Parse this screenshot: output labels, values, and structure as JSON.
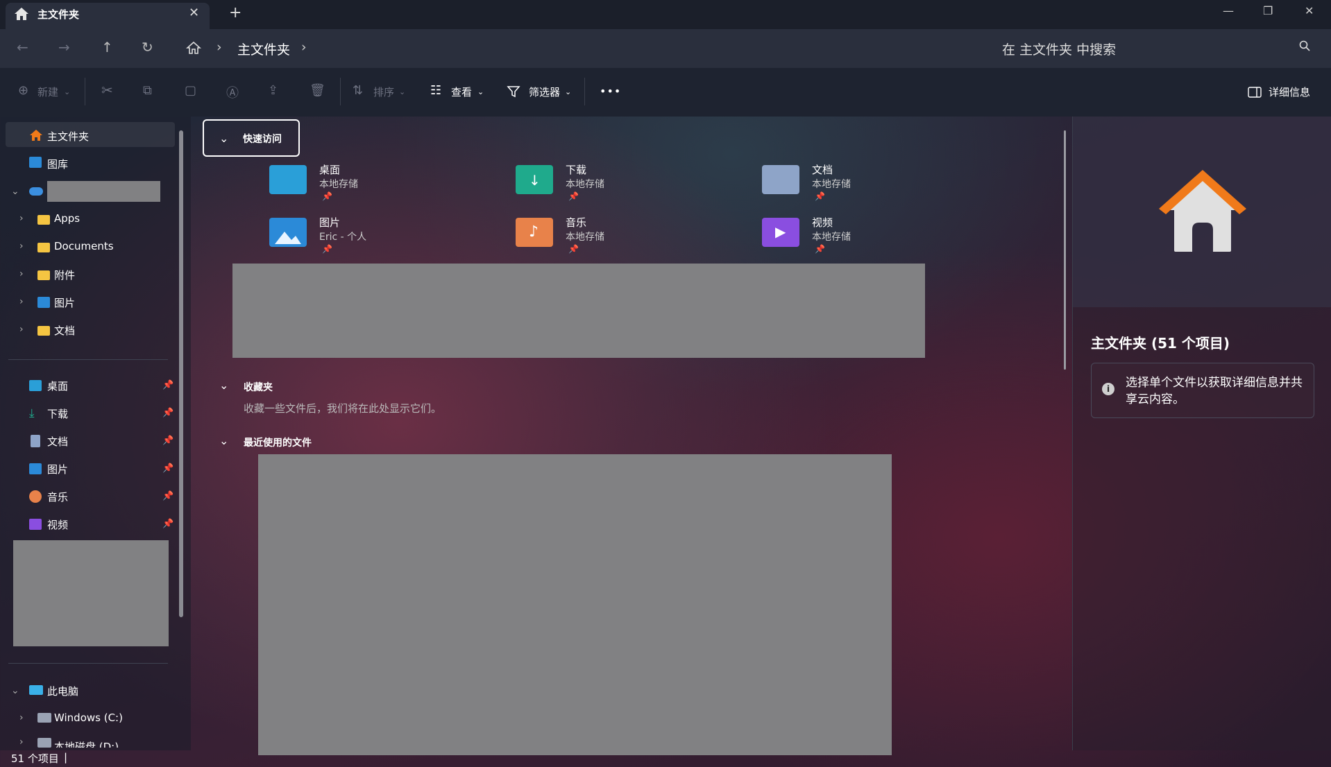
{
  "titlebar": {
    "tab_title": "主文件夹",
    "tab_close": "✕",
    "new_tab": "+",
    "minimize": "—",
    "restore": "❐",
    "close": "✕"
  },
  "nav": {
    "back": "←",
    "forward": "→",
    "up": "↑",
    "refresh": "↻",
    "breadcrumb": "主文件夹",
    "search_placeholder": "在 主文件夹 中搜索"
  },
  "toolbar": {
    "new_label": "新建",
    "sort_label": "排序",
    "view_label": "查看",
    "filter_label": "筛选器",
    "more_label": "•••",
    "details_label": "详细信息"
  },
  "sidebar": {
    "home": "主文件夹",
    "gallery": "图库",
    "onedrive_children": [
      "Apps",
      "Documents",
      "附件",
      "图片",
      "文档"
    ],
    "pinned": [
      "桌面",
      "下载",
      "文档",
      "图片",
      "音乐",
      "视频"
    ],
    "this_pc": "此电脑",
    "drives": [
      "Windows (C:)",
      "本地磁盘 (D:)"
    ]
  },
  "quick_access": {
    "header": "快速访问",
    "tiles": [
      {
        "name": "桌面",
        "sub": "本地存储"
      },
      {
        "name": "下载",
        "sub": "本地存储"
      },
      {
        "name": "文档",
        "sub": "本地存储"
      },
      {
        "name": "图片",
        "sub": "Eric - 个人"
      },
      {
        "name": "音乐",
        "sub": "本地存储"
      },
      {
        "name": "视频",
        "sub": "本地存储"
      }
    ]
  },
  "favorites": {
    "header": "收藏夹",
    "empty_text": "收藏一些文件后，我们将在此处显示它们。"
  },
  "recent": {
    "header": "最近使用的文件"
  },
  "details_pane": {
    "title": "主文件夹 (51 个项目)",
    "info": "选择单个文件以获取详细信息并共享云内容。"
  },
  "status": {
    "count": "51 个项目",
    "sep": "|"
  },
  "colors": {
    "accent_home": "#f07a1a",
    "desktop_folder": "#2a9fd8",
    "downloads_folder": "#1faa8c",
    "documents_folder": "#8ea4c8",
    "pictures_folder": "#2b8ad8",
    "music_folder": "#e8824a",
    "videos_folder": "#8a4ee0"
  }
}
